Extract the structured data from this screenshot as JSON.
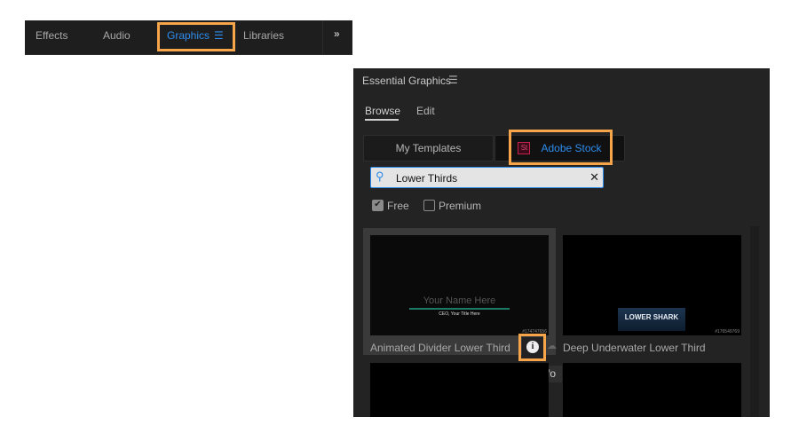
{
  "top_tabs": {
    "items": [
      "Effects",
      "Audio",
      "Graphics",
      "Libraries"
    ],
    "active": "Graphics",
    "overflow": "»"
  },
  "panel": {
    "title": "Essential Graphics",
    "tabs": [
      "Browse",
      "Edit"
    ],
    "active_tab": "Browse",
    "source_buttons": {
      "my_templates": "My Templates",
      "adobe_stock": "Adobe Stock",
      "stock_badge": "St"
    },
    "search": {
      "value": "Lower Thirds",
      "placeholder": ""
    },
    "filters": {
      "free": {
        "label": "Free",
        "checked": true
      },
      "premium": {
        "label": "Premium",
        "checked": false
      }
    },
    "templates": [
      {
        "title": "Animated Divider Lower Third",
        "id": "#174747656",
        "preview_name": "Your Name Here",
        "preview_title": "CEO, Your Title Here"
      },
      {
        "title": "Deep Underwater Lower Third",
        "id": "#176549769",
        "preview_name": "LOWER SHARK"
      }
    ],
    "tooltip": "Info"
  },
  "colors": {
    "accent": "#2d8ceb",
    "highlight": "#f7a54a",
    "panel": "#232323",
    "stock_badge": "#c4214f"
  }
}
